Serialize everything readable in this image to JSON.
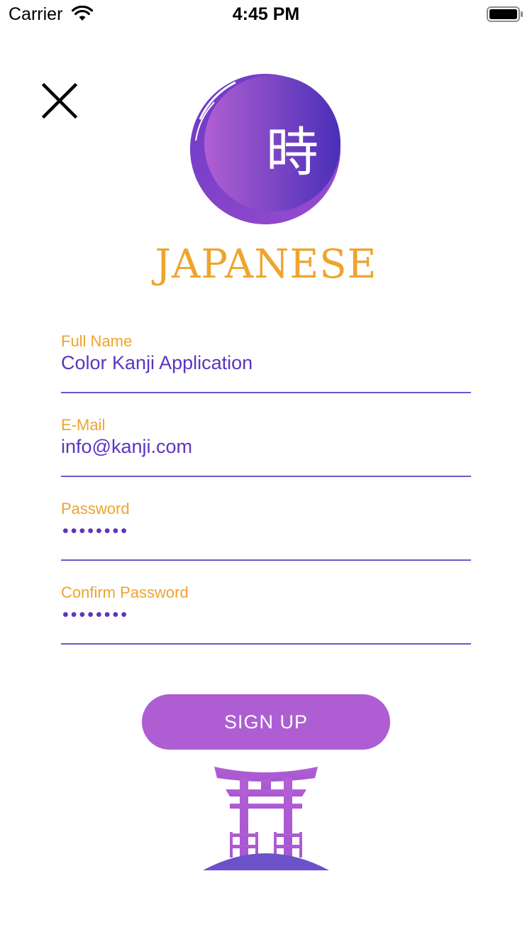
{
  "status_bar": {
    "carrier": "Carrier",
    "time": "4:45 PM"
  },
  "icons": {
    "close": "close-icon",
    "wifi": "wifi-icon",
    "battery": "battery-icon",
    "logo": "kanji-logo",
    "illustration": "torii-gate-icon"
  },
  "logo": {
    "kanji": "時",
    "title": "JAPANESE"
  },
  "form": {
    "full_name": {
      "label": "Full Name",
      "value": "Color Kanji Application"
    },
    "email": {
      "label": "E-Mail",
      "value": "info@kanji.com"
    },
    "password": {
      "label": "Password",
      "value": "••••••••"
    },
    "confirm_password": {
      "label": "Confirm Password",
      "value": "••••••••"
    }
  },
  "buttons": {
    "signup": "SIGN UP"
  },
  "colors": {
    "accent_orange": "#EFA42E",
    "primary_purple": "#5B36C0",
    "button_purple": "#AE5DD3",
    "underline": "#6F57CC"
  }
}
